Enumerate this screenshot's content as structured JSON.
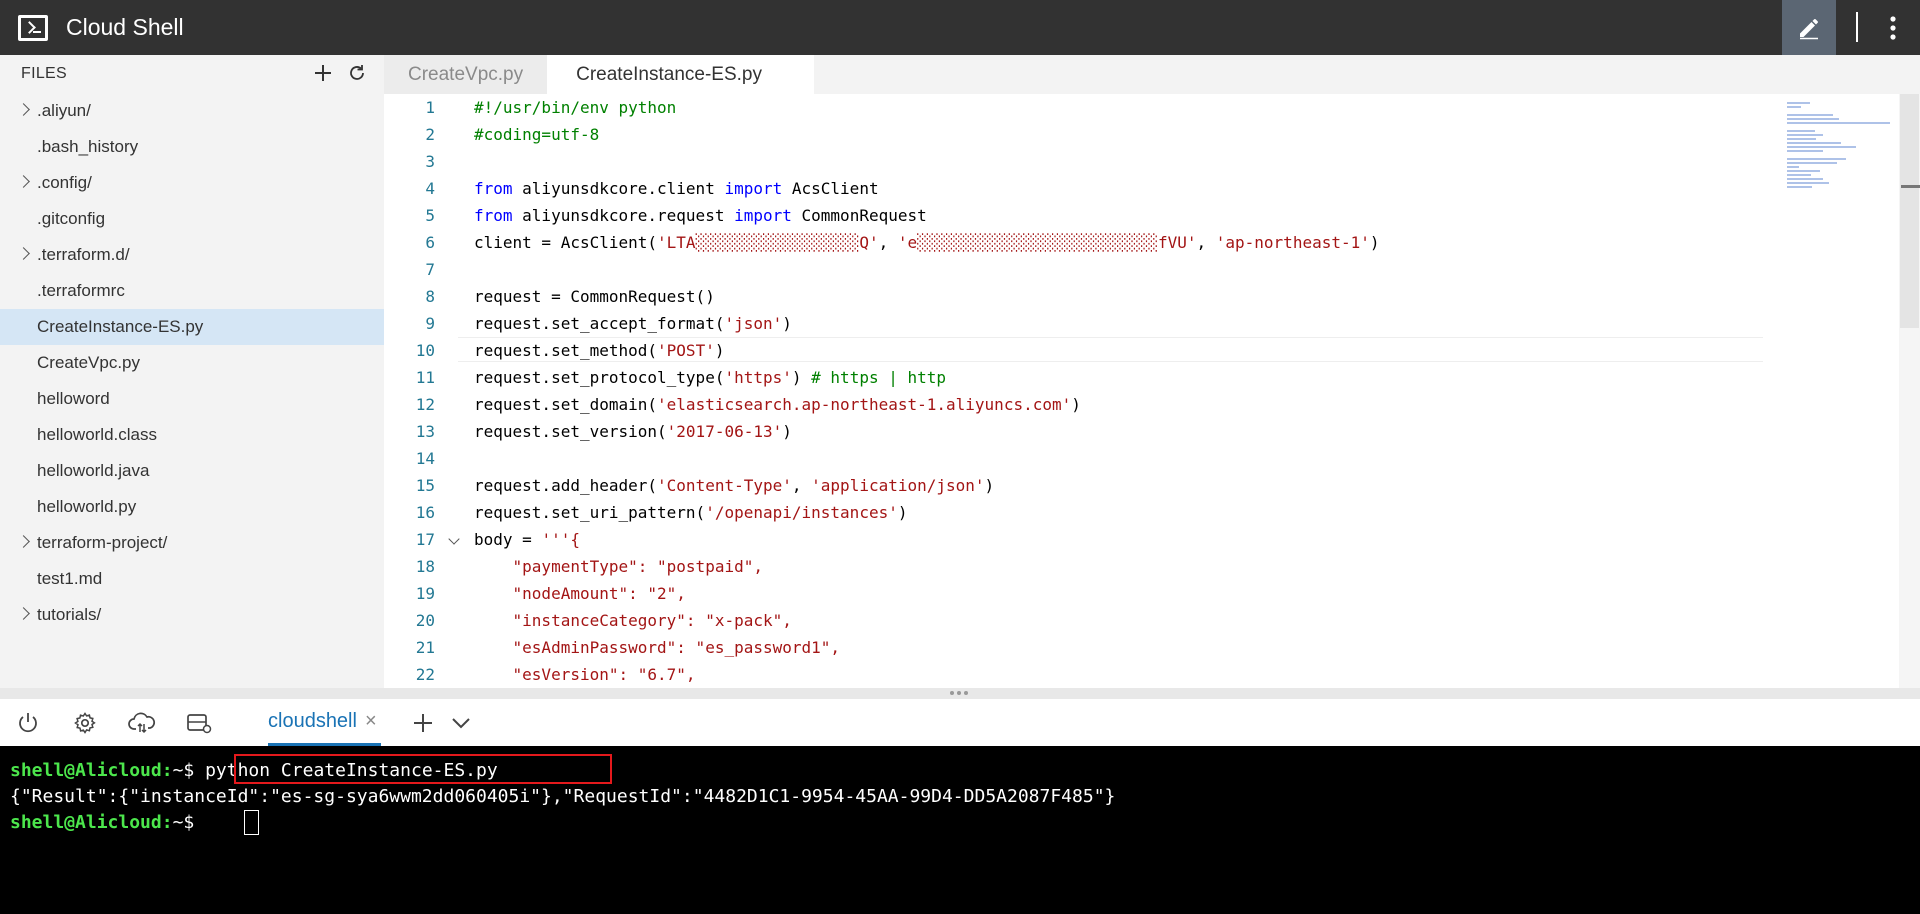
{
  "header": {
    "title": "Cloud Shell"
  },
  "sidebar": {
    "heading": "FILES",
    "items": [
      {
        "label": ".aliyun/",
        "folder": true
      },
      {
        "label": ".bash_history",
        "folder": false
      },
      {
        "label": ".config/",
        "folder": true
      },
      {
        "label": ".gitconfig",
        "folder": false
      },
      {
        "label": ".terraform.d/",
        "folder": true
      },
      {
        "label": ".terraformrc",
        "folder": false
      },
      {
        "label": "CreateInstance-ES.py",
        "folder": false,
        "selected": true
      },
      {
        "label": "CreateVpc.py",
        "folder": false
      },
      {
        "label": "helloword",
        "folder": false
      },
      {
        "label": "helloworld.class",
        "folder": false
      },
      {
        "label": "helloworld.java",
        "folder": false
      },
      {
        "label": "helloworld.py",
        "folder": false
      },
      {
        "label": "terraform-project/",
        "folder": true
      },
      {
        "label": "test1.md",
        "folder": false
      },
      {
        "label": "tutorials/",
        "folder": true
      }
    ]
  },
  "editor": {
    "tabs": [
      {
        "label": "CreateVpc.py",
        "active": false
      },
      {
        "label": "CreateInstance-ES.py",
        "active": true
      }
    ],
    "lines": [
      {
        "n": "1",
        "parts": [
          {
            "t": "#!/usr/bin/env python",
            "c": "c"
          }
        ]
      },
      {
        "n": "2",
        "parts": [
          {
            "t": "#coding=utf-8",
            "c": "c"
          }
        ]
      },
      {
        "n": "3",
        "parts": []
      },
      {
        "n": "4",
        "parts": [
          {
            "t": "from",
            "c": "k"
          },
          {
            "t": " aliyunsdkcore.client "
          },
          {
            "t": "import",
            "c": "k"
          },
          {
            "t": " AcsClient"
          }
        ]
      },
      {
        "n": "5",
        "parts": [
          {
            "t": "from",
            "c": "k"
          },
          {
            "t": " aliyunsdkcore.request "
          },
          {
            "t": "import",
            "c": "k"
          },
          {
            "t": " CommonRequest"
          }
        ]
      },
      {
        "n": "6",
        "parts": [
          {
            "t": "client = AcsClient("
          },
          {
            "t": "'LTA░░░░░░░░░░░░░░░░░Q'",
            "c": "s"
          },
          {
            "t": ", "
          },
          {
            "t": "'e░░░░░░░░░░░░░░░░░░░░░░░░░fVU'",
            "c": "s"
          },
          {
            "t": ", "
          },
          {
            "t": "'ap-northeast-1'",
            "c": "s"
          },
          {
            "t": ")"
          }
        ]
      },
      {
        "n": "7",
        "parts": []
      },
      {
        "n": "8",
        "parts": [
          {
            "t": "request = CommonRequest()"
          }
        ]
      },
      {
        "n": "9",
        "parts": [
          {
            "t": "request.set_accept_format("
          },
          {
            "t": "'json'",
            "c": "s"
          },
          {
            "t": ")"
          }
        ]
      },
      {
        "n": "10",
        "parts": [
          {
            "t": "request.set_method("
          },
          {
            "t": "'POST'",
            "c": "s"
          },
          {
            "t": ")"
          }
        ]
      },
      {
        "n": "11",
        "parts": [
          {
            "t": "request.set_protocol_type("
          },
          {
            "t": "'https'",
            "c": "s"
          },
          {
            "t": ") "
          },
          {
            "t": "# https | http",
            "c": "c"
          }
        ]
      },
      {
        "n": "12",
        "parts": [
          {
            "t": "request.set_domain("
          },
          {
            "t": "'elasticsearch.ap-northeast-1.aliyuncs.com'",
            "c": "s"
          },
          {
            "t": ")"
          }
        ]
      },
      {
        "n": "13",
        "parts": [
          {
            "t": "request.set_version("
          },
          {
            "t": "'2017-06-13'",
            "c": "s"
          },
          {
            "t": ")"
          }
        ]
      },
      {
        "n": "14",
        "parts": []
      },
      {
        "n": "15",
        "parts": [
          {
            "t": "request.add_header("
          },
          {
            "t": "'Content-Type'",
            "c": "s"
          },
          {
            "t": ", "
          },
          {
            "t": "'application/json'",
            "c": "s"
          },
          {
            "t": ")"
          }
        ]
      },
      {
        "n": "16",
        "parts": [
          {
            "t": "request.set_uri_pattern("
          },
          {
            "t": "'/openapi/instances'",
            "c": "s"
          },
          {
            "t": ")"
          }
        ]
      },
      {
        "n": "17",
        "fold": true,
        "parts": [
          {
            "t": "body = "
          },
          {
            "t": "'''{",
            "c": "s"
          }
        ]
      },
      {
        "n": "18",
        "parts": [
          {
            "t": "    "
          },
          {
            "t": "\"paymentType\": \"postpaid\",",
            "c": "s"
          }
        ]
      },
      {
        "n": "19",
        "parts": [
          {
            "t": "    "
          },
          {
            "t": "\"nodeAmount\": \"2\",",
            "c": "s"
          }
        ]
      },
      {
        "n": "20",
        "parts": [
          {
            "t": "    "
          },
          {
            "t": "\"instanceCategory\": \"x-pack\",",
            "c": "s"
          }
        ]
      },
      {
        "n": "21",
        "parts": [
          {
            "t": "    "
          },
          {
            "t": "\"esAdminPassword\": \"es_password1\",",
            "c": "s"
          }
        ]
      },
      {
        "n": "22",
        "parts": [
          {
            "t": "    "
          },
          {
            "t": "\"esVersion\": \"6.7\",",
            "c": "s"
          }
        ]
      }
    ]
  },
  "terminal": {
    "tab_label": "cloudshell",
    "close_glyph": "×",
    "prompt": "shell@Alicloud:",
    "prompt_suffix": "~$ ",
    "command": "python CreateInstance-ES.py",
    "output": "{\"Result\":{\"instanceId\":\"es-sg-sya6wwm2dd060405i\"},\"RequestId\":\"4482D1C1-9954-45AA-99D4-DD5A2087F485\"}"
  },
  "colors": {
    "accent": "#1a73b5",
    "prompt": "#4ce64c",
    "highlight": "#e4191c"
  }
}
